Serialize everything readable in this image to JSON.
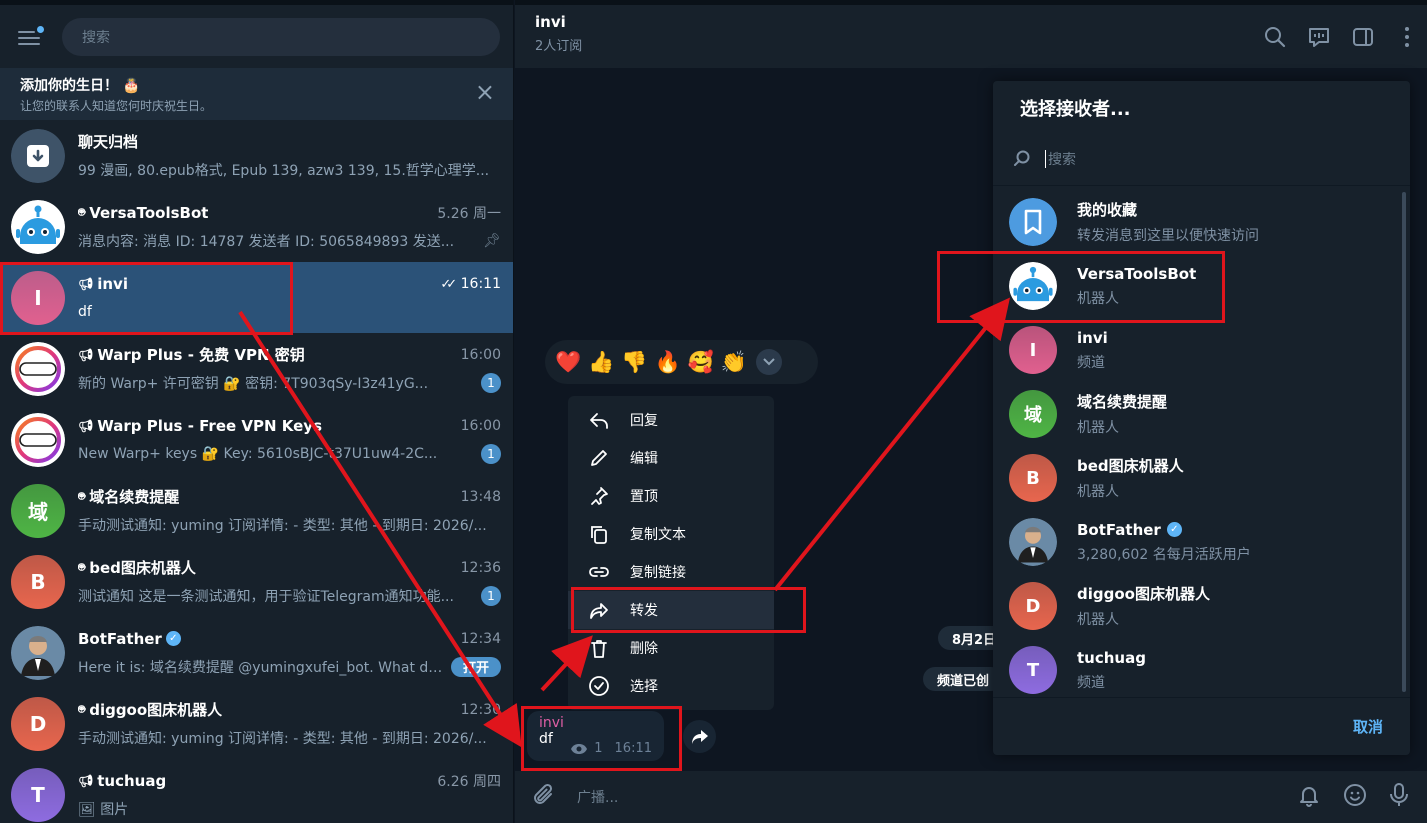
{
  "left": {
    "search_placeholder": "搜索",
    "birthday": {
      "title": "添加你的生日！ 🎂",
      "subtitle": "让您的联系人知道您何时庆祝生日。"
    },
    "chats": [
      {
        "name": "聊天归档",
        "time": "",
        "preview": "99 漫画, 80.epub格式, Epub 139, azw3 139, 15.哲学心理学...",
        "avatar_text": "",
        "avatar_color": "#3e5368",
        "type": "archive",
        "badge": ""
      },
      {
        "name": "VersaToolsBot",
        "time": "5.26 周一",
        "preview": "消息内容: 消息 ID: 14787  发送者 ID: 5065849893 发送...",
        "avatar_text": "",
        "avatar_color": "#ffffff",
        "type": "bot",
        "badge": "",
        "pinned": true
      },
      {
        "name": "invi",
        "time": "16:11",
        "preview": "df",
        "avatar_text": "I",
        "avatar_color": "#e1608f",
        "type": "channel",
        "badge": "",
        "active": true
      },
      {
        "name": "Warp Plus - 免费 VPN 密钥",
        "time": "16:00",
        "preview": "新的 Warp+ 许可密钥 🔐 密钥: 7T903qSy-I3z41yG...",
        "avatar_text": "WARP+",
        "avatar_color": "#ffffff",
        "type": "channel",
        "badge": "1"
      },
      {
        "name": "Warp Plus - Free VPN Keys",
        "time": "16:00",
        "preview": "New Warp+ keys 🔐 Key: 5610sBJC-t37U1uw4-2C...",
        "avatar_text": "WARP+",
        "avatar_color": "#ffffff",
        "type": "channel",
        "badge": "1"
      },
      {
        "name": "域名续费提醒",
        "time": "13:48",
        "preview": "手动测试通知: yuming  订阅详情: - 类型: 其他 - 到期日: 2026/...",
        "avatar_text": "域",
        "avatar_color": "#4fb545",
        "type": "bot",
        "badge": ""
      },
      {
        "name": "bed图床机器人",
        "time": "12:36",
        "preview": "测试通知  这是一条测试通知，用于验证Telegram通知功能...",
        "avatar_text": "B",
        "avatar_color": "#e8664e",
        "type": "bot",
        "badge": "1"
      },
      {
        "name": "BotFather",
        "time": "12:34",
        "preview": "Here it is: 域名续费提醒 @yumingxufei_bot. What do...",
        "avatar_text": "",
        "avatar_color": "#6a8aa6",
        "type": "none",
        "verified": true,
        "badge_wide": "打开"
      },
      {
        "name": "diggoo图床机器人",
        "time": "12:30",
        "preview": "手动测试通知: yuming  订阅详情: - 类型: 其他 - 到期日: 2026/...",
        "avatar_text": "D",
        "avatar_color": "#e8664e",
        "type": "bot",
        "badge": ""
      },
      {
        "name": "tuchuag",
        "time": "6.26 周四",
        "preview": "🖼 图片",
        "avatar_text": "T",
        "avatar_color": "#8e6ce0",
        "type": "channel",
        "badge": ""
      }
    ]
  },
  "header": {
    "title": "invi",
    "subtitle": "2人订阅"
  },
  "reactions": [
    "❤️",
    "👍",
    "👎",
    "🔥",
    "🥰",
    "👏"
  ],
  "context_menu": [
    {
      "label": "回复",
      "icon": "reply-icon"
    },
    {
      "label": "编辑",
      "icon": "edit-icon"
    },
    {
      "label": "置顶",
      "icon": "pin-icon"
    },
    {
      "label": "复制文本",
      "icon": "copy-icon"
    },
    {
      "label": "复制链接",
      "icon": "link-icon"
    },
    {
      "label": "转发",
      "icon": "forward-icon"
    },
    {
      "label": "删除",
      "icon": "delete-icon"
    },
    {
      "label": "选择",
      "icon": "select-icon"
    }
  ],
  "message": {
    "author": "invi",
    "text": "df",
    "views": "1",
    "time": "16:11"
  },
  "service": {
    "date": "8月2日",
    "channel_created": "频道已创"
  },
  "composer": {
    "placeholder": "广播..."
  },
  "picker": {
    "title": "选择接收者...",
    "search_placeholder": "搜索",
    "items": [
      {
        "name": "我的收藏",
        "sub": "转发消息到这里以便快速访问",
        "avatar_text": "",
        "avatar_color": "#4d9be0",
        "kind": "saved"
      },
      {
        "name": "VersaToolsBot",
        "sub": "机器人",
        "avatar_text": "",
        "avatar_color": "#ffffff",
        "kind": "bot"
      },
      {
        "name": "invi",
        "sub": "频道",
        "avatar_text": "I",
        "avatar_color": "#e1608f",
        "kind": "letter"
      },
      {
        "name": "域名续费提醒",
        "sub": "机器人",
        "avatar_text": "域",
        "avatar_color": "#4fb545",
        "kind": "letter"
      },
      {
        "name": "bed图床机器人",
        "sub": "机器人",
        "avatar_text": "B",
        "avatar_color": "#e8664e",
        "kind": "letter"
      },
      {
        "name": "BotFather",
        "sub": "3,280,602 名每月活跃用户",
        "avatar_text": "",
        "avatar_color": "#6a8aa6",
        "kind": "botfather",
        "verified": true
      },
      {
        "name": "diggoo图床机器人",
        "sub": "机器人",
        "avatar_text": "D",
        "avatar_color": "#e8664e",
        "kind": "letter"
      },
      {
        "name": "tuchuag",
        "sub": "频道",
        "avatar_text": "T",
        "avatar_color": "#8e6ce0",
        "kind": "letter"
      }
    ],
    "cancel_label": "取消"
  },
  "colors": {
    "accent": "#5eb5f7",
    "annotation_red": "#e0151c",
    "active_chat": "#2b5278"
  }
}
